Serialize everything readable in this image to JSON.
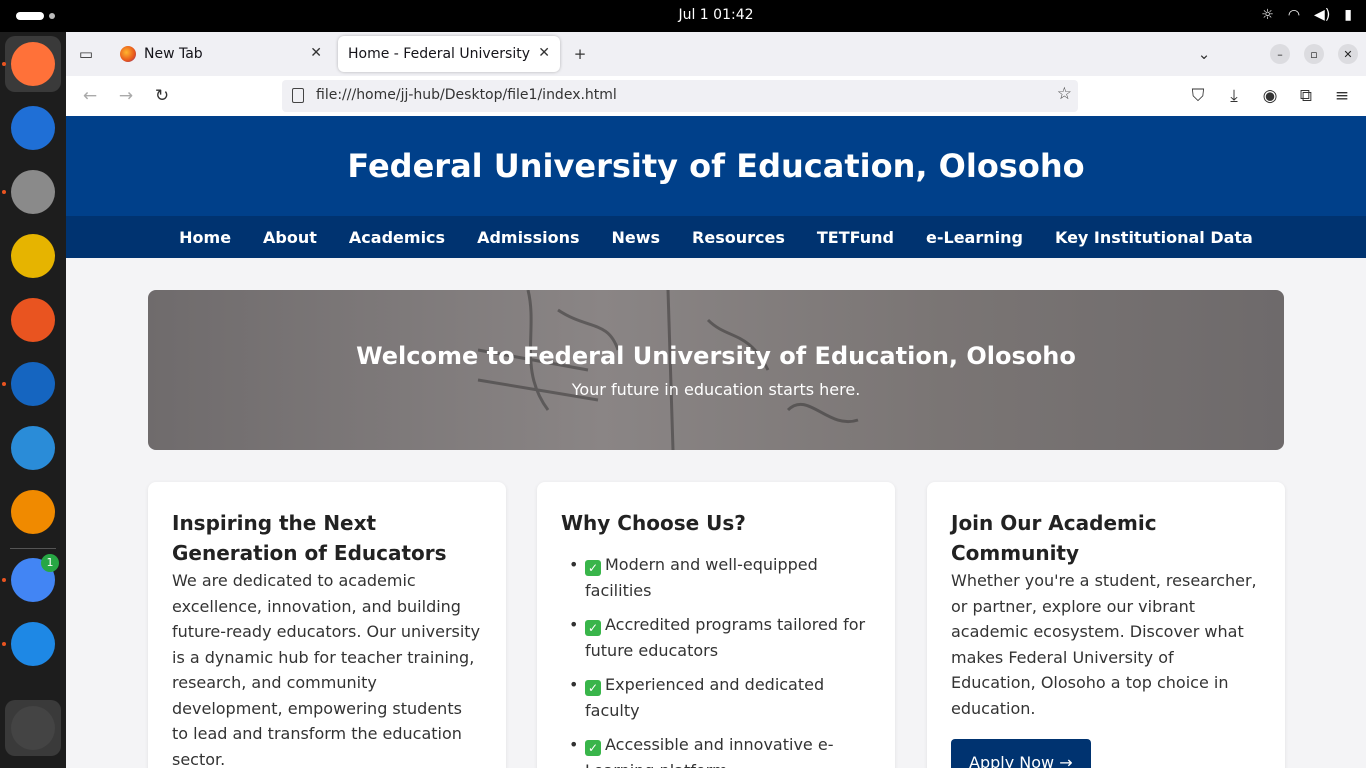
{
  "system": {
    "clock": "Jul 1  01:42",
    "tray_icons": [
      "brightness-icon",
      "wifi-icon",
      "volume-icon",
      "battery-icon"
    ]
  },
  "dock": {
    "apps": [
      {
        "name": "Firefox",
        "icon": "firefox-icon",
        "color": "#ff7139"
      },
      {
        "name": "Thunderbird",
        "icon": "thunderbird-icon",
        "color": "#1f6fd6"
      },
      {
        "name": "Files",
        "icon": "files-icon",
        "color": "#8a8a8a"
      },
      {
        "name": "Rhythmbox",
        "icon": "rhythmbox-icon",
        "color": "#e6b400"
      },
      {
        "name": "App Center",
        "icon": "app-center-icon",
        "color": "#e95420"
      },
      {
        "name": "LibreOffice Writer",
        "icon": "writer-icon",
        "color": "#1565c0"
      },
      {
        "name": "Help",
        "icon": "help-icon",
        "color": "#2a8cd8"
      },
      {
        "name": "VLC",
        "icon": "vlc-icon",
        "color": "#f08a00"
      },
      {
        "name": "Chrome",
        "icon": "chrome-icon",
        "color": "#4285f4",
        "badge": "1"
      },
      {
        "name": "VS Code",
        "icon": "vscode-icon",
        "color": "#1e88e5"
      },
      {
        "name": "Show Apps",
        "icon": "ubuntu-icon",
        "color": "#444444"
      }
    ]
  },
  "browser": {
    "tabs": [
      {
        "title": "New Tab"
      },
      {
        "title": "Home - Federal University of Education"
      }
    ],
    "url": "file:///home/jj-hub/Desktop/file1/index.html"
  },
  "site": {
    "title": "Federal University of Education, Olosoho",
    "nav": [
      "Home",
      "About",
      "Academics",
      "Admissions",
      "News",
      "Resources",
      "TETFund",
      "e-Learning",
      "Key Institutional Data"
    ],
    "hero": {
      "heading": "Welcome to Federal University of Education, Olosoho",
      "subheading": "Your future in education starts here."
    },
    "cards": {
      "inspire": {
        "heading": "Inspiring the Next Generation of Educators",
        "body": "We are dedicated to academic excellence, innovation, and building future-ready educators. Our university is a dynamic hub for teacher training, research, and community development, empowering students to lead and transform the education sector."
      },
      "why": {
        "heading": "Why Choose Us?",
        "items": [
          "Modern and well-equipped facilities",
          "Accredited programs tailored for future educators",
          "Experienced and dedicated faculty",
          "Accessible and innovative e-Learning platform"
        ]
      },
      "join": {
        "heading": "Join Our Academic Community",
        "body": "Whether you're a student, researcher, or partner, explore our vibrant academic ecosystem. Discover what makes Federal University of Education, Olosoho a top choice in education.",
        "button": "Apply Now →"
      }
    },
    "colors": {
      "header": "#00408a",
      "nav": "#003370",
      "button": "#003370"
    }
  }
}
